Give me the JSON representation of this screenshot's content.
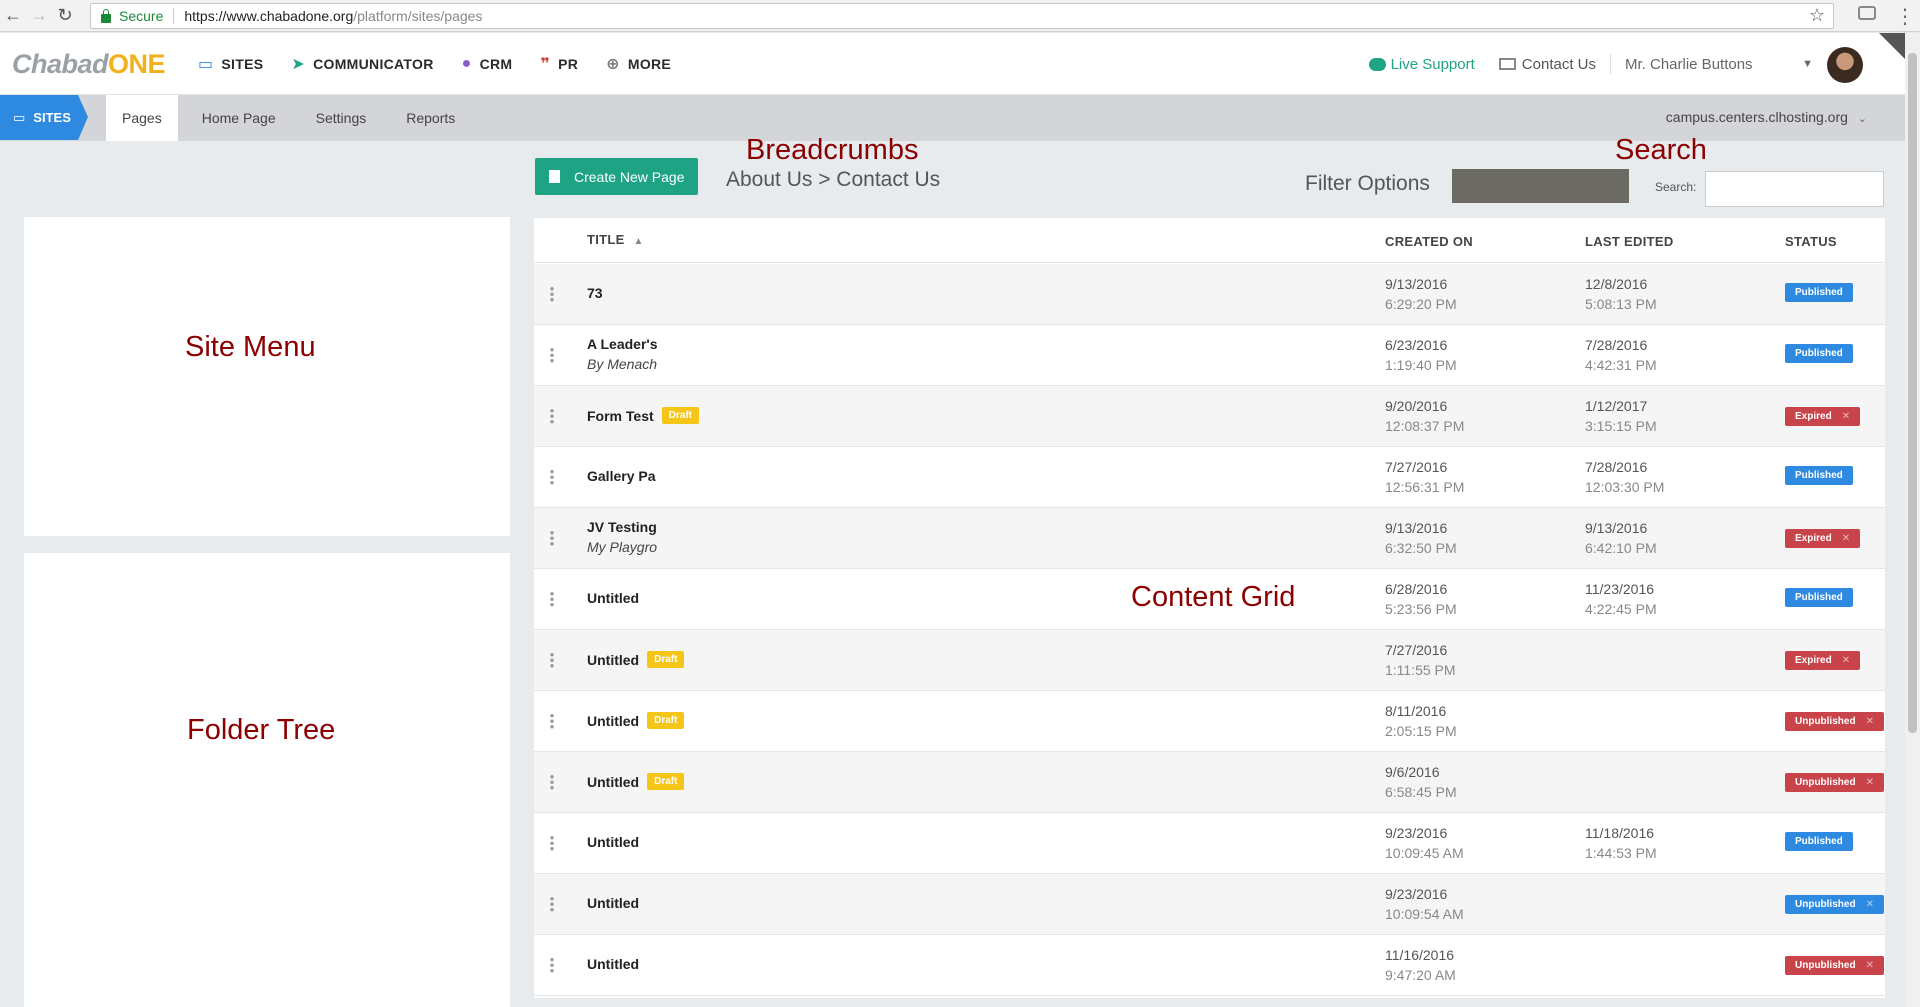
{
  "browser": {
    "secure_label": "Secure",
    "url_host": "https://www.chabadone.org",
    "url_path": "/platform/sites/pages"
  },
  "header": {
    "logo_part1": "Chabad",
    "logo_part2": "ONE",
    "nav": [
      {
        "label": "SITES",
        "icon": "laptop-icon"
      },
      {
        "label": "COMMUNICATOR",
        "icon": "paper-plane-icon"
      },
      {
        "label": "CRM",
        "icon": "people-icon"
      },
      {
        "label": "PR",
        "icon": "quote-icon"
      },
      {
        "label": "MORE",
        "icon": "plus-circle-icon"
      }
    ],
    "live_support": "Live Support",
    "contact_us": "Contact Us",
    "user_name": "Mr. Charlie Buttons"
  },
  "subnav": {
    "section": "SITES",
    "tabs": [
      "Pages",
      "Home Page",
      "Settings",
      "Reports"
    ],
    "active_tab": "Pages",
    "host": "campus.centers.clhosting.org"
  },
  "annotations": {
    "breadcrumbs": "Breadcrumbs",
    "search": "Search",
    "site_menu": "Site Menu",
    "folder_tree": "Folder Tree",
    "content_grid": "Content Grid",
    "filter_options": "Filter Options"
  },
  "toolbar": {
    "create_label": "Create New Page",
    "breadcrumb_path": "About Us > Contact Us",
    "search_label": "Search:"
  },
  "grid": {
    "columns": {
      "title": "TITLE",
      "created": "CREATED ON",
      "edited": "LAST EDITED",
      "status": "STATUS"
    },
    "rows": [
      {
        "title": "73",
        "subtitle": "",
        "draft": "",
        "created_date": "9/13/2016",
        "created_time": "6:29:20 PM",
        "edited_date": "12/8/2016",
        "edited_time": "5:08:13 PM",
        "status": "Published",
        "status_type": "published"
      },
      {
        "title": "A Leader's",
        "subtitle": "By Menach",
        "draft": "",
        "created_date": "6/23/2016",
        "created_time": "1:19:40 PM",
        "edited_date": "7/28/2016",
        "edited_time": "4:42:31 PM",
        "status": "Published",
        "status_type": "published"
      },
      {
        "title": "Form Test",
        "subtitle": "",
        "draft": "Draft",
        "created_date": "9/20/2016",
        "created_time": "12:08:37 PM",
        "edited_date": "1/12/2017",
        "edited_time": "3:15:15 PM",
        "status": "Expired",
        "status_type": "expired"
      },
      {
        "title": "Gallery Pa",
        "subtitle": "",
        "draft": "",
        "created_date": "7/27/2016",
        "created_time": "12:56:31 PM",
        "edited_date": "7/28/2016",
        "edited_time": "12:03:30 PM",
        "status": "Published",
        "status_type": "published"
      },
      {
        "title": "JV Testing",
        "subtitle": "My Playgro",
        "draft": "",
        "created_date": "9/13/2016",
        "created_time": "6:32:50 PM",
        "edited_date": "9/13/2016",
        "edited_time": "6:42:10 PM",
        "status": "Expired",
        "status_type": "expired"
      },
      {
        "title": "Untitled",
        "subtitle": "",
        "draft": "",
        "created_date": "6/28/2016",
        "created_time": "5:23:56 PM",
        "edited_date": "11/23/2016",
        "edited_time": "4:22:45 PM",
        "status": "Published",
        "status_type": "published"
      },
      {
        "title": "Untitled",
        "subtitle": "",
        "draft": "Draft",
        "created_date": "7/27/2016",
        "created_time": "1:11:55 PM",
        "edited_date": "",
        "edited_time": "",
        "status": "Expired",
        "status_type": "expired"
      },
      {
        "title": "Untitled",
        "subtitle": "",
        "draft": "Draft",
        "created_date": "8/11/2016",
        "created_time": "2:05:15 PM",
        "edited_date": "",
        "edited_time": "",
        "status": "Unpublished",
        "status_type": "unpublished"
      },
      {
        "title": "Untitled",
        "subtitle": "",
        "draft": "Draft",
        "created_date": "9/6/2016",
        "created_time": "6:58:45 PM",
        "edited_date": "",
        "edited_time": "",
        "status": "Unpublished",
        "status_type": "unpublished"
      },
      {
        "title": "Untitled",
        "subtitle": "",
        "draft": "",
        "created_date": "9/23/2016",
        "created_time": "10:09:45 AM",
        "edited_date": "11/18/2016",
        "edited_time": "1:44:53 PM",
        "status": "Published",
        "status_type": "published"
      },
      {
        "title": "Untitled",
        "subtitle": "",
        "draft": "",
        "created_date": "9/23/2016",
        "created_time": "10:09:54 AM",
        "edited_date": "",
        "edited_time": "",
        "status": "Unpublished",
        "status_type": "unpub-blue"
      },
      {
        "title": "Untitled",
        "subtitle": "",
        "draft": "",
        "created_date": "11/16/2016",
        "created_time": "9:47:20 AM",
        "edited_date": "",
        "edited_time": "",
        "status": "Unpublished",
        "status_type": "unpublished"
      }
    ]
  },
  "colors": {
    "brand_green": "#1fa385",
    "sites_blue": "#2d8ae0",
    "draft_yellow": "#f5c518",
    "expired_red": "#c9444a",
    "annotation_red": "#8b0000"
  }
}
